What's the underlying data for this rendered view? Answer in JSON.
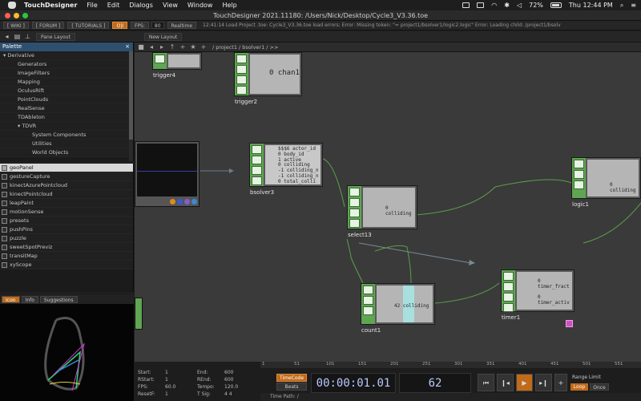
{
  "menubar": {
    "app_name": "TouchDesigner",
    "menus": [
      "File",
      "Edit",
      "Dialogs",
      "View",
      "Window",
      "Help"
    ],
    "battery": "72%",
    "clock": "Thu 12:44 PM",
    "battery_level": 0.72
  },
  "window": {
    "title": "TouchDesigner 2021.11180: /Users/Nick/Desktop/Cycle3_V3.36.toe"
  },
  "toolbar1": {
    "wiki": "[ WIKI ]",
    "forum": "[ FORUM ]",
    "tutorials": "[ TUTORIALS ]",
    "oi": "O|I",
    "fps_label": "FPS:",
    "fps_value": "80",
    "realtime": "Realtime",
    "status": "12:41:14 Load Project .toe: Cycle3_V3.36.toe load errors:   Error: Missing token: \"= project1/bsolver1/logic2.logic\"   Error: Loading child: /project1/bsolv"
  },
  "toolbar2": {
    "pane_layout": "Pane Layout",
    "new_layout": "New Layout"
  },
  "palette": {
    "header": "Palette",
    "close": "×",
    "items": [
      {
        "label": "▾ Derivative",
        "indent": 0
      },
      {
        "label": "Generators",
        "indent": 1
      },
      {
        "label": "ImageFilters",
        "indent": 1
      },
      {
        "label": "Mapping",
        "indent": 1
      },
      {
        "label": "OculusRift",
        "indent": 1
      },
      {
        "label": "PointClouds",
        "indent": 1
      },
      {
        "label": "RealSense",
        "indent": 1
      },
      {
        "label": "TDAbleton",
        "indent": 1
      },
      {
        "label": "▾ TDVR",
        "indent": 1
      },
      {
        "label": "System Components",
        "indent": 2
      },
      {
        "label": "Utilities",
        "indent": 2
      },
      {
        "label": "World Objects",
        "indent": 2
      }
    ]
  },
  "components": [
    "geoPanel",
    "gestureCapture",
    "kinectAzurePointcloud",
    "kinectPointcloud",
    "leapPaint",
    "motionSense",
    "presets",
    "pushPins",
    "puzzle",
    "sweetSpotPreviz",
    "transitMap",
    "xyScope"
  ],
  "preview_tabs": [
    "Icon",
    "Info",
    "Suggestions"
  ],
  "network": {
    "path": "/ project1 / bsolver1 / >>",
    "nodes": {
      "trigger4": {
        "name": "trigger4"
      },
      "trigger2": {
        "name": "trigger2",
        "channel": "0 chan1"
      },
      "bsolver3": {
        "name": "bsolver3",
        "rows": [
          "$$$6  actor_id",
          "0  body_id",
          "1  active",
          "0  colliding",
          "-1  colliding_n",
          "-1  colliding_n",
          "0  total_colli"
        ]
      },
      "select13": {
        "name": "select13",
        "channel": "0  colliding"
      },
      "count1": {
        "name": "count1",
        "channel": "42  colliding"
      },
      "timer1": {
        "name": "timer1",
        "rows": [
          "0  timer_fract",
          "0  timer_activ"
        ]
      },
      "logic1": {
        "name": "logic1",
        "channel": "0  colliding"
      }
    }
  },
  "timeline": {
    "ticks": [
      "1",
      "51",
      "101",
      "151",
      "201",
      "251",
      "301",
      "351",
      "401",
      "451",
      "501",
      "551"
    ],
    "start_label": "Start:",
    "start": "1",
    "end_label": "End:",
    "end": "600",
    "rstart_label": "RStart:",
    "rstart": "1",
    "rend_label": "REnd:",
    "rend": "600",
    "fps_label": "FPS:",
    "fps": "60.0",
    "tempo_label": "Tempo:",
    "tempo": "120.0",
    "resetf_label": "ResetF:",
    "resetf": "1",
    "tsig_label": "T Sig:",
    "tsig": "4 4",
    "timecode_btn": "TimeCode",
    "beats_btn": "Beats",
    "timecode": "00:00:01.01",
    "frame": "62",
    "range_limit": "Range Limit",
    "loop": "Loop",
    "once": "Once",
    "time_path": "Time Path: /"
  }
}
